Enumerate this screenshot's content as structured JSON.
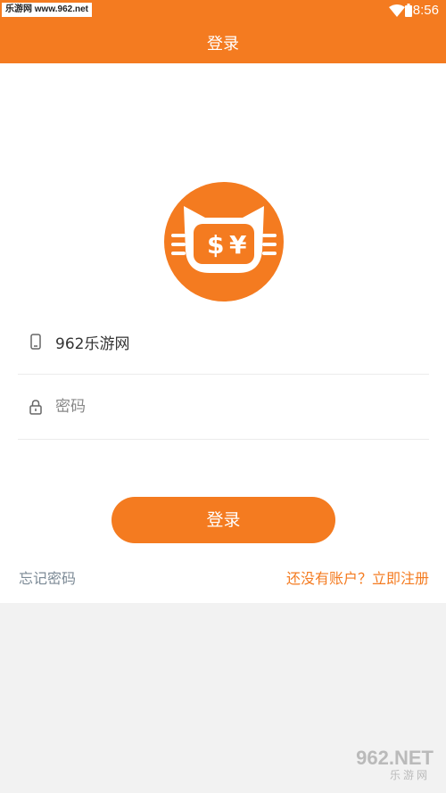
{
  "status_bar": {
    "watermark_text": "乐游网 www.962.net",
    "time": "8:56"
  },
  "header": {
    "title": "登录"
  },
  "logo": {
    "icon": "cat-money-logo",
    "symbols": "$ ¥"
  },
  "form": {
    "phone": {
      "icon": "phone-icon",
      "value": "962乐游网",
      "placeholder": ""
    },
    "password": {
      "icon": "lock-icon",
      "value": "",
      "placeholder": "密码"
    },
    "login_label": "登录"
  },
  "links": {
    "forgot": "忘记密码",
    "register": "还没有账户？立即注册"
  },
  "watermark": {
    "brand": "962.NET",
    "sub": "乐游网"
  },
  "colors": {
    "accent": "#f47b20",
    "background": "#f2f2f2",
    "link_gray": "#7c8a96"
  }
}
